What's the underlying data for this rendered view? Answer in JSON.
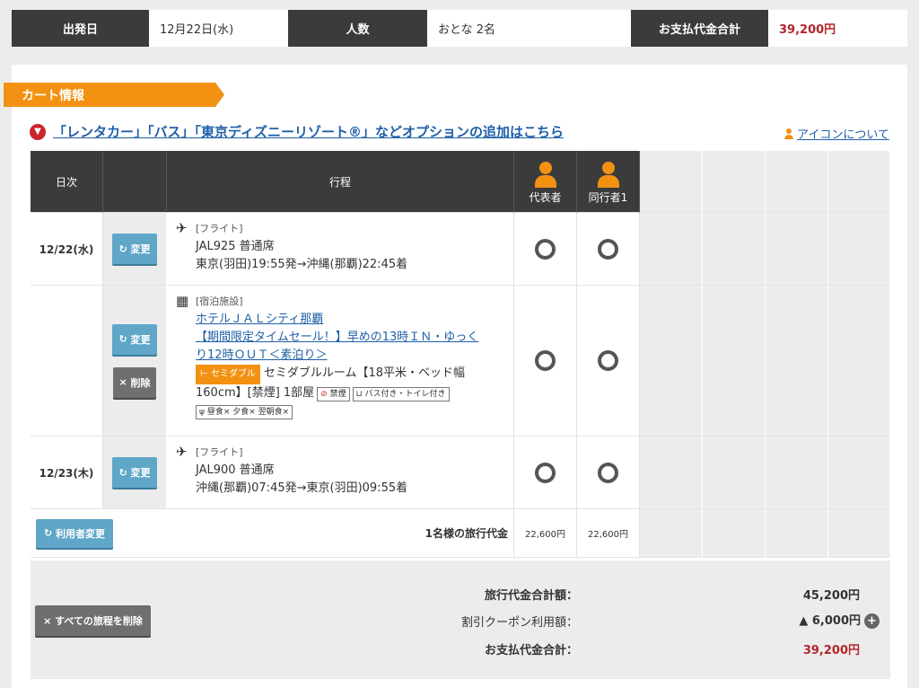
{
  "summary": {
    "departure_label": "出発日",
    "departure_value": "12月22日(水)",
    "people_label": "人数",
    "people_value": "おとな 2名",
    "total_label": "お支払代金合計",
    "total_value": "39,200円"
  },
  "cart": {
    "ribbon": "カート情報",
    "option_link": "「レンタカー」「バス」「東京ディズニーリゾート®」などオプションの追加はこちら",
    "icon_about": "アイコンについて"
  },
  "table": {
    "headers": {
      "date": "日次",
      "itinerary": "行程",
      "rep": "代表者",
      "companion": "同行者1"
    },
    "rows": [
      {
        "date": "12/22(水)",
        "change": "変更",
        "tag": "[フライト]",
        "line1": "JAL925 普通席",
        "line2": "東京(羽田)19:55発→沖縄(那覇)22:45着"
      },
      {
        "change": "変更",
        "delete": "削除",
        "tag": "[宿泊施設]",
        "hotel": "ホテルＪＡＬシティ那覇",
        "plan1": "【期間限定タイムセール！】早めの13時ＩＮ・ゆっく",
        "plan2": "り12時ＯＵＴ＜素泊り＞",
        "room_badge": "セミダブル",
        "room1": "セミダブルルーム【18平米・ベッド幅",
        "room2": "160cm】[禁煙] 1部屋",
        "chip_nosmoke": "禁煙",
        "chip_bath": "バス付き・トイレ付き",
        "meals": "昼食× 夕食× 翌朝食×"
      },
      {
        "date": "12/23(木)",
        "change": "変更",
        "tag": "[フライト]",
        "line1": "JAL900 普通席",
        "line2": "沖縄(那覇)07:45発→東京(羽田)09:55着"
      }
    ],
    "user_change": "利用者変更",
    "per_person_label": "1名様の旅行代金",
    "per_person_rep": "22,600円",
    "per_person_companion": "22,600円"
  },
  "totals": {
    "delete_all": "すべての旅程を削除",
    "travel_total_label": "旅行代金合計額：",
    "travel_total_value": "45,200円",
    "coupon_label": "割引クーポン利用額：",
    "coupon_value": "▲ 6,000円",
    "pay_label": "お支払代金合計：",
    "pay_value": "39,200円",
    "accent": "#b4262a"
  }
}
